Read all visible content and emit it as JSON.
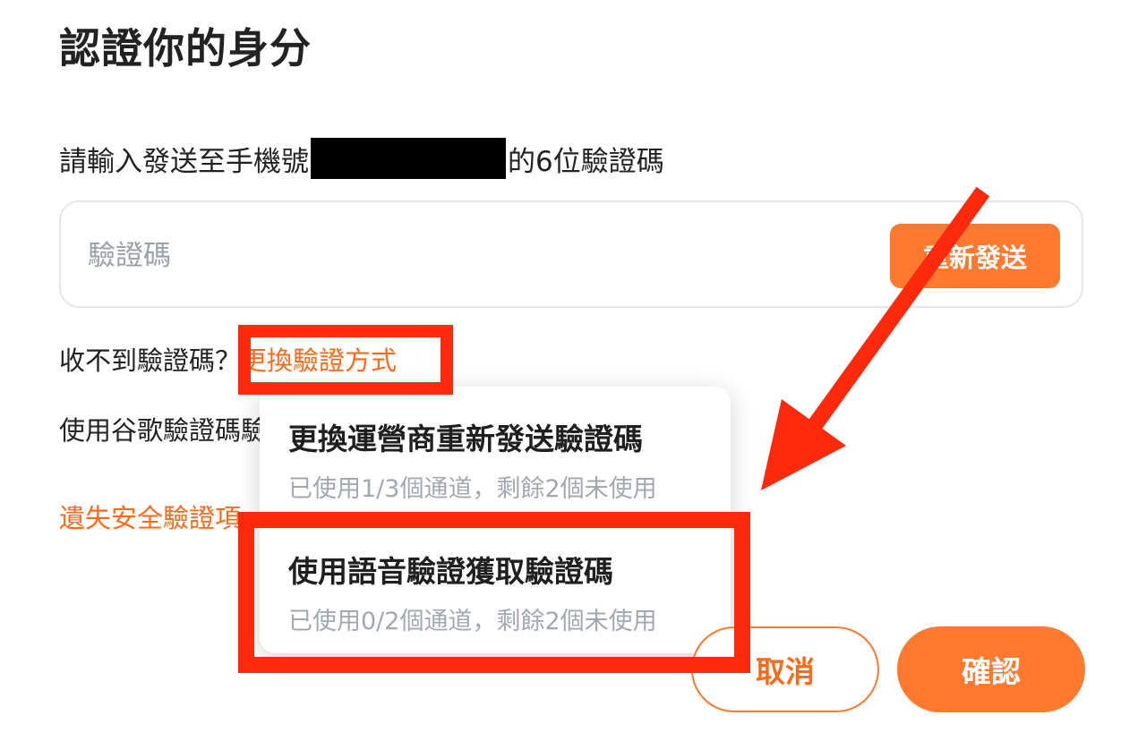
{
  "page": {
    "title": "認證你的身分",
    "instruction_prefix": "請輸入發送至手機號",
    "instruction_suffix": "的6位驗證碼"
  },
  "code_input": {
    "placeholder": "驗證碼",
    "value": "",
    "resend_label": "重新發送"
  },
  "help": {
    "no_code_label": "收不到驗證碼？",
    "change_method_link": "更換驗證方式",
    "google_auth_text": "使用谷歌驗證碼驗",
    "lost_security_link": "遺失安全驗證項"
  },
  "menu": {
    "options": [
      {
        "title": "更換運營商重新發送驗證碼",
        "subtitle": "已使用1/3個通道，剩餘2個未使用"
      },
      {
        "title": "使用語音驗證獲取驗證碼",
        "subtitle": "已使用0/2個通道，剩餘2個未使用"
      }
    ]
  },
  "footer": {
    "cancel_label": "取消",
    "confirm_label": "確認"
  },
  "colors": {
    "accent": "#ff7a2f",
    "link": "#ff6a1a",
    "annotation_red": "#ff2a0e",
    "muted_text": "#a3a8b0"
  },
  "icons": {
    "annotation_arrow": "arrow-down-left-icon"
  }
}
